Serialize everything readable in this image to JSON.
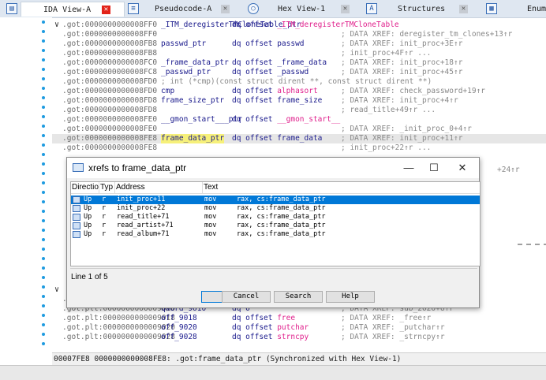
{
  "tabs": [
    {
      "label": "IDA View-A",
      "icon": "ida-view-icon",
      "active": true
    },
    {
      "label": "Pseudocode-A",
      "icon": "pseudocode-icon",
      "active": false
    },
    {
      "label": "Hex View-1",
      "icon": "hex-view-icon",
      "active": false
    },
    {
      "label": "Structures",
      "icon": "structures-icon",
      "active": false
    },
    {
      "label": "Enums",
      "icon": "enums-icon",
      "active": false
    }
  ],
  "code_lines": [
    {
      "addr": ".got:0000000000008FF0",
      "name": "_ITM_deregisterTMCloneTable_ptr",
      "op": "dq offset ",
      "op_pink": "_ITM_deregisterTMCloneTable",
      "cmt": ""
    },
    {
      "addr": ".got:0000000000008FF0",
      "name": "",
      "op": "",
      "op_pink": "",
      "cmt": "; DATA XREF: deregister_tm_clones+13↑r"
    },
    {
      "addr": ".got:0000000000008FB8",
      "name": "passwd_ptr",
      "op": "dq offset passwd",
      "op_pink": "",
      "cmt": "; DATA XREF: init_proc+3E↑r"
    },
    {
      "addr": ".got:0000000000008FB8",
      "name": "",
      "op": "",
      "op_pink": "",
      "cmt": "; init_proc+4F↑r ..."
    },
    {
      "addr": ".got:0000000000008FC0",
      "name": "_frame_data_ptr",
      "op": "dq offset _frame_data",
      "op_pink": "",
      "cmt": "; DATA XREF: init_proc+18↑r"
    },
    {
      "addr": ".got:0000000000008FC8",
      "name": "_passwd_ptr",
      "op": "dq offset _passwd",
      "op_pink": "",
      "cmt": "; DATA XREF: init_proc+45↑r"
    },
    {
      "addr": ".got:0000000000008FD0",
      "full": "; int (*cmp)(const struct dirent **, const struct dirent **)"
    },
    {
      "addr": ".got:0000000000008FD0",
      "name": "cmp",
      "op": "dq offset ",
      "op_pink": "alphasort",
      "cmt": "; DATA XREF: check_password+19↑r"
    },
    {
      "addr": ".got:0000000000008FD8",
      "name": "frame_size_ptr",
      "op": "dq offset frame_size",
      "op_pink": "",
      "cmt": "; DATA XREF: init_proc+4↑r"
    },
    {
      "addr": ".got:0000000000008FD8",
      "name": "",
      "op": "",
      "op_pink": "",
      "cmt": "; read_title+49↑r ..."
    },
    {
      "addr": ".got:0000000000008FE0",
      "name": "__gmon_start___ptr",
      "op": "dq offset ",
      "op_pink": "__gmon_start__",
      "cmt": ""
    },
    {
      "addr": ".got:0000000000008FE0",
      "name": "",
      "op": "",
      "op_pink": "",
      "cmt": "; DATA XREF: _init_proc_0+4↑r"
    },
    {
      "addr": ".got:0000000000008FE8",
      "name": "frame_data_ptr",
      "op": "dq offset frame_data",
      "op_pink": "",
      "cmt": "; DATA XREF: init_proc+11↑r",
      "highlight": true
    },
    {
      "addr": ".got:0000000000008FE8",
      "name": "",
      "op": "",
      "op_pink": "",
      "cmt": "; init_proc+22↑r ..."
    }
  ],
  "peek_text": "+24↑r",
  "bottom_lines": [
    {
      "addr": ".got.plt:0000000000009008",
      "name": "qword_9008",
      "op": "dq 0",
      "op_pink": "",
      "cmt": "; DATA XREF: sub_2020↑r"
    },
    {
      "addr": ".got.plt:0000000000009010",
      "name": "qword_9010",
      "op": "dq 0",
      "op_pink": "",
      "cmt": "; DATA XREF: sub_2020+6↑r"
    },
    {
      "addr": ".got.plt:0000000000009018",
      "name": "off_9018",
      "op": "dq offset ",
      "op_pink": "free",
      "cmt": "; DATA XREF: _free↑r"
    },
    {
      "addr": ".got.plt:0000000000009020",
      "name": "off_9020",
      "op": "dq offset ",
      "op_pink": "putchar",
      "cmt": "; DATA XREF: _putchar↑r"
    },
    {
      "addr": ".got.plt:0000000000009028",
      "name": "off_9028",
      "op": "dq offset ",
      "op_pink": "strncpy",
      "cmt": "; DATA XREF: _strncpy↑r"
    }
  ],
  "status_text": "00007FE8 0000000000008FE8: .got:frame_data_ptr (Synchronized with Hex View-1)",
  "dialog": {
    "title": "xrefs to frame_data_ptr",
    "columns": [
      "Directio",
      "Typ",
      "Address",
      "Text"
    ],
    "rows": [
      {
        "direction": "Up",
        "type": "r",
        "address": "init_proc+11",
        "text": "mov     rax, cs:frame_data_ptr",
        "selected": true
      },
      {
        "direction": "Up",
        "type": "r",
        "address": "init_proc+22",
        "text": "mov     rax, cs:frame_data_ptr",
        "selected": false
      },
      {
        "direction": "Up",
        "type": "r",
        "address": "read_title+71",
        "text": "mov     rax, cs:frame_data_ptr",
        "selected": false
      },
      {
        "direction": "Up",
        "type": "r",
        "address": "read_artist+71",
        "text": "mov     rax, cs:frame_data_ptr",
        "selected": false
      },
      {
        "direction": "Up",
        "type": "r",
        "address": "read_album+71",
        "text": "mov     rax, cs:frame_data_ptr",
        "selected": false
      }
    ],
    "line_count": "Line 1 of 5",
    "buttons": {
      "ok": "OK",
      "cancel": "Cancel",
      "search": "Search",
      "help": "Help"
    },
    "window_controls": {
      "minimize": "—",
      "maximize": "☐",
      "close": "✕"
    }
  },
  "colors": {
    "accent": "#0078d7",
    "pink": "#e0208c",
    "highlight": "#f6f07a"
  }
}
